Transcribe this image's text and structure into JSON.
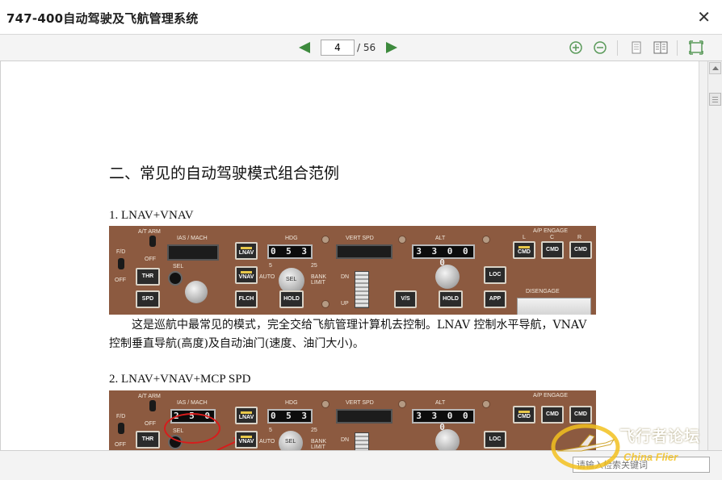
{
  "window": {
    "title": "747-400自动驾驶及飞航管理系统",
    "close_glyph": "✕"
  },
  "toolbar": {
    "current_page": "4",
    "page_total": "/ 56",
    "icons": [
      "prev-page-icon",
      "next-page-icon",
      "zoom-in-icon",
      "zoom-out-icon",
      "single-page-icon",
      "two-page-icon",
      "fullscreen-icon"
    ],
    "accent_color": "#3d8a3d"
  },
  "document": {
    "heading": "二、常见的自动驾驶模式组合范例",
    "section1_title": "1. LNAV+VNAV",
    "section1_text": "这是巡航中最常见的模式，完全交给飞航管理计算机去控制。LNAV 控制水平导航，VNAV 控制垂直导航(高度)及自动油门(速度、油门大小)。",
    "section2_title": "2. LNAV+VNAV+MCP SPD"
  },
  "mcp_panel": {
    "labels": {
      "at_arm": "A/T ARM",
      "fd": "F/D",
      "off": "OFF",
      "ias_mach": "IAS / MACH",
      "sel": "SEL",
      "hdg": "HDG",
      "vert_spd": "VERT SPD",
      "alt": "ALT",
      "ap_engage": "A/P ENGAGE",
      "l": "L",
      "c": "C",
      "r": "R",
      "auto": "AUTO",
      "bank_limit": "BANK\nLIMIT",
      "bank_5": "5",
      "bank_25": "25",
      "dn": "DN",
      "up": "UP",
      "disengage": "DISENGAGE"
    },
    "buttons": {
      "thr": "THR",
      "spd": "SPD",
      "lnav": "LNAV",
      "vnav": "VNAV",
      "flch": "FLCH",
      "hold": "HOLD",
      "vs": "V/S",
      "loc": "LOC",
      "app": "APP",
      "cmd": "CMD"
    },
    "panel1_displays": {
      "hdg": "0 5 3",
      "alt": "3 3 0 0 0"
    },
    "panel2_displays": {
      "ias": "2 5 0",
      "hdg": "0 5 3",
      "alt": "3 3 0 0 0"
    }
  },
  "statusbar": {
    "search_placeholder": "请输入检索关键词"
  },
  "watermark": {
    "cn": "飞行者论坛",
    "en": "China Flier"
  }
}
